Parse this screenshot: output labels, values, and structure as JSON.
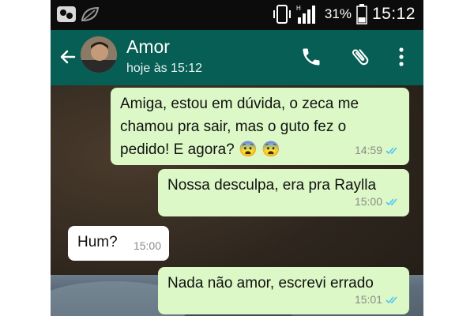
{
  "status_bar": {
    "battery_percent": "31%",
    "clock": "15:12",
    "icons": [
      "chat-heads-icon",
      "leaf-icon",
      "vibrate-icon",
      "signal-icon",
      "battery-icon"
    ]
  },
  "toolbar": {
    "contact_name": "Amor",
    "contact_status": "hoje às 15:12",
    "icons": [
      "back-arrow-icon",
      "phone-icon",
      "paperclip-icon",
      "more-vert-icon"
    ],
    "color": "#075e54"
  },
  "messages": [
    {
      "direction": "out",
      "text_lines": [
        "Amiga, estou em dúvida, o zeca me",
        "chamou pra sair, mas o guto fez o",
        "pedido! E agora? 😨 😨"
      ],
      "time": "14:59",
      "read": true
    },
    {
      "direction": "out",
      "text_lines": [
        "Nossa desculpa, era pra Raylla"
      ],
      "time": "15:00",
      "read": true
    },
    {
      "direction": "in",
      "text_lines": [
        "Hum?"
      ],
      "time": "15:00"
    },
    {
      "direction": "out",
      "text_lines": [
        "Nada não amor, escrevi errado"
      ],
      "time": "15:01",
      "read": true
    }
  ],
  "colors": {
    "outgoing_bubble": "#dcf8c6",
    "incoming_bubble": "#ffffff",
    "read_ticks": "#4fc3f7"
  }
}
